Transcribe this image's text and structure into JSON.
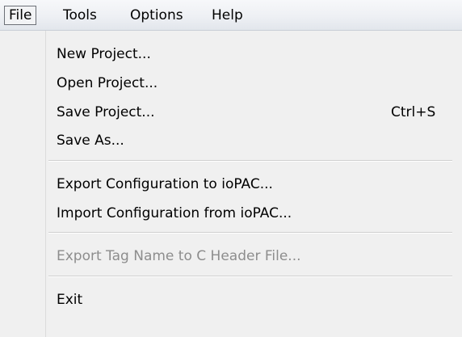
{
  "menubar": {
    "items": [
      {
        "label": "File",
        "open": true
      },
      {
        "label": "Tools"
      },
      {
        "label": "Options"
      },
      {
        "label": "Help"
      }
    ]
  },
  "file_menu": {
    "items": [
      {
        "label": "New Project...",
        "shortcut": "",
        "enabled": true
      },
      {
        "label": "Open Project...",
        "shortcut": "",
        "enabled": true
      },
      {
        "label": "Save Project...",
        "shortcut": "Ctrl+S",
        "enabled": true
      },
      {
        "label": "Save As...",
        "shortcut": "",
        "enabled": true
      },
      {
        "label": "Export Configuration to ioPAC...",
        "shortcut": "",
        "enabled": true
      },
      {
        "label": "Import Configuration from ioPAC...",
        "shortcut": "",
        "enabled": true
      },
      {
        "label": "Export Tag Name to C Header File...",
        "shortcut": "",
        "enabled": false
      },
      {
        "label": "Exit",
        "shortcut": "",
        "enabled": true
      }
    ]
  }
}
